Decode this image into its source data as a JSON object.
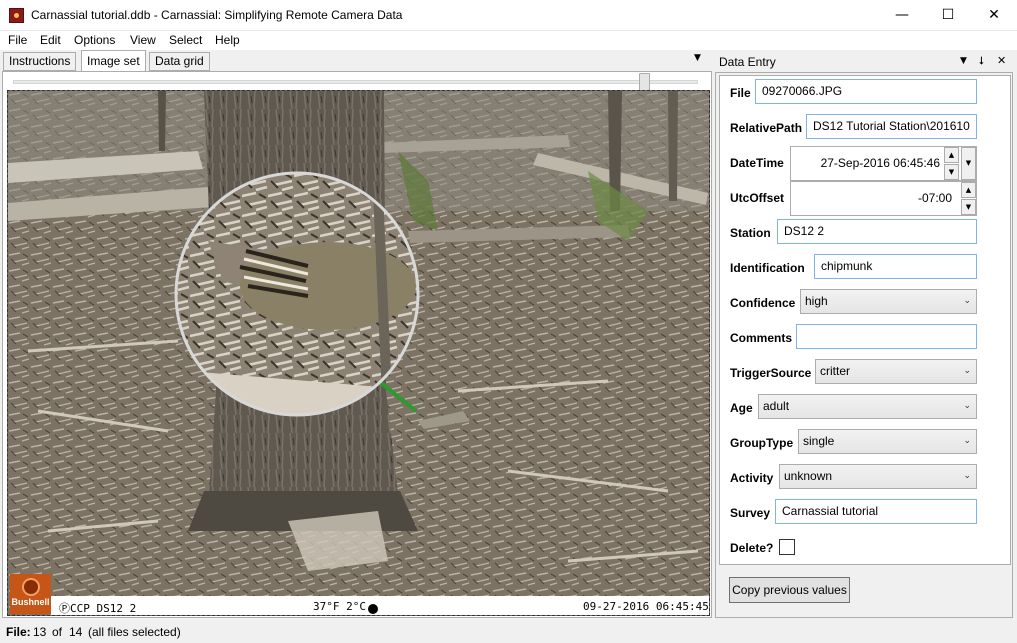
{
  "window": {
    "title": "Carnassial tutorial.ddb - Carnassial: Simplifying Remote Camera Data",
    "minimize": "—",
    "maximize": "☐",
    "close": "✕"
  },
  "menu": [
    "File",
    "Edit",
    "Options",
    "View",
    "Select",
    "Help"
  ],
  "tabs": [
    "Instructions",
    "Image set",
    "Data grid"
  ],
  "active_tab": "Image set",
  "image": {
    "slider_fraction": 0.93,
    "camera_brand": "Bushnell",
    "camera_id": "CCP DS12 2",
    "temperature": "37°F 2°C",
    "timestamp": "09-27-2016 06:45:45"
  },
  "data_entry": {
    "title": "Data Entry",
    "pin": "⭣",
    "close": "✕",
    "menu_arrow": "▼",
    "fields": {
      "file": {
        "label": "File",
        "value": "09270066.JPG"
      },
      "relative_path": {
        "label": "RelativePath",
        "value": "DS12 Tutorial Station\\201610"
      },
      "datetime": {
        "label": "DateTime",
        "value": "27-Sep-2016 06:45:46"
      },
      "utc_offset": {
        "label": "UtcOffset",
        "value": "-07:00"
      },
      "station": {
        "label": "Station",
        "value": "DS12 2"
      },
      "identification": {
        "label": "Identification",
        "value": "chipmunk"
      },
      "confidence": {
        "label": "Confidence",
        "value": "high"
      },
      "comments": {
        "label": "Comments",
        "value": ""
      },
      "trigger_source": {
        "label": "TriggerSource",
        "value": "critter"
      },
      "age": {
        "label": "Age",
        "value": "adult"
      },
      "group_type": {
        "label": "GroupType",
        "value": "single"
      },
      "activity": {
        "label": "Activity",
        "value": "unknown"
      },
      "survey": {
        "label": "Survey",
        "value": "Carnassial tutorial"
      },
      "delete": {
        "label": "Delete?",
        "checked": false
      }
    },
    "copy_button": "Copy previous values"
  },
  "status": {
    "label": "File:",
    "current": "13",
    "of": "of",
    "total": "14",
    "selection": "(all files selected)"
  }
}
